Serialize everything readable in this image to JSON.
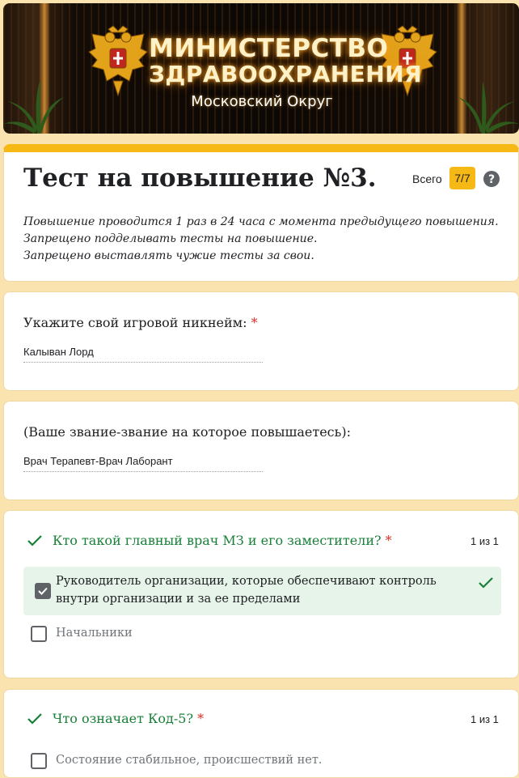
{
  "banner": {
    "line1": "МИНИСТЕРСТВО",
    "line2": "ЗДРАВООХРАНЕНИЯ",
    "subtitle": "Московский Округ"
  },
  "header": {
    "title": "Тест на повышение №3.",
    "total_label": "Всего",
    "score": "7/7",
    "description": [
      "Повышение проводится 1 раз в 24 часа с момента предыдущего повышения.",
      "Запрещено подделывать тесты на повышение.",
      "Запрещено выставлять чужие тесты за свои."
    ]
  },
  "questions": [
    {
      "label": "Укажите свой игровой никнейм:",
      "required": "*",
      "answer": "Калыван Лорд"
    },
    {
      "label": "(Ваше звание-звание на которое повышаетесь):",
      "answer": "Врач Терапевт-Врач Лаборант"
    },
    {
      "label": "Кто такой главный врач МЗ и его заместители?",
      "required": "*",
      "points": "1 из 1",
      "options": [
        {
          "text_line1": "Руководитель организации, которые обеспечивают контроль",
          "text_line2": "внутри организации и за ее пределами",
          "checked": true
        },
        {
          "text": "Начальники",
          "checked": false
        }
      ]
    },
    {
      "label": "Что означает Код-5?",
      "required": "*",
      "points": "1 из 1",
      "options": [
        {
          "text": "Состояние стабильное, происшествий нет.",
          "checked": false
        }
      ]
    }
  ],
  "colors": {
    "accent": "#f6b814",
    "page_background": "#fbe3b0",
    "correct": "#188038",
    "correct_background": "#e6f4ea",
    "required": "#d93025"
  },
  "icons": [
    "eagle-emblem",
    "help-icon",
    "check-icon",
    "checkbox"
  ]
}
